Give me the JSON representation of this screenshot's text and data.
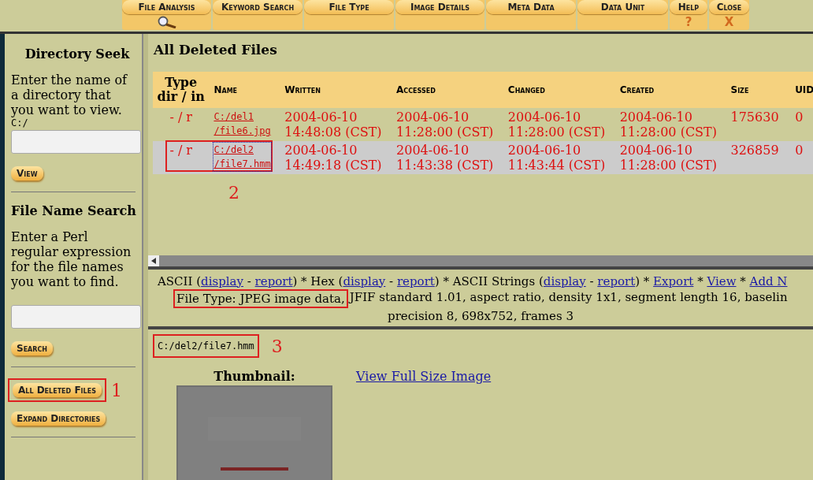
{
  "toolbar": {
    "tabs": [
      {
        "label": "File Analysis",
        "selected": true
      },
      {
        "label": "Keyword Search",
        "selected": false
      },
      {
        "label": "File Type",
        "selected": false
      },
      {
        "label": "Image Details",
        "selected": false
      },
      {
        "label": "Meta Data",
        "selected": false
      },
      {
        "label": "Data Unit",
        "selected": false
      },
      {
        "label": "Help",
        "selected": false,
        "glyph": "?"
      },
      {
        "label": "Close",
        "selected": false,
        "glyph": "X"
      }
    ]
  },
  "sidebar": {
    "sections": [
      {
        "title": "Directory Seek",
        "text": "Enter the name of a directory that you want to view.",
        "prefix": "C:/",
        "button": "View"
      },
      {
        "title": "File Name Search",
        "text": "Enter a Perl regular expression for the file names you want to find.",
        "button": "Search"
      }
    ],
    "actions": [
      {
        "label": "All Deleted Files",
        "highlighted": true,
        "marker": "1"
      },
      {
        "label": "Expand Directories",
        "highlighted": false
      }
    ]
  },
  "list": {
    "title": "All Deleted Files",
    "columns": [
      "Type dir / in",
      "Name",
      "Written",
      "Accessed",
      "Changed",
      "Created",
      "Size",
      "UID"
    ],
    "rows": [
      {
        "type": "- / r",
        "name": [
          "C:/del1",
          "/file6.jpg"
        ],
        "written": [
          "2004-06-10",
          "14:48:08 (CST)"
        ],
        "accessed": [
          "2004-06-10",
          "11:28:00 (CST)"
        ],
        "changed": [
          "2004-06-10",
          "11:28:00 (CST)"
        ],
        "created": [
          "2004-06-10",
          "11:28:00 (CST)"
        ],
        "size": "175630",
        "uid": "0",
        "selected": false,
        "highlighted": false
      },
      {
        "type": "- / r",
        "name": [
          "C:/del2",
          "/file7.hmm"
        ],
        "written": [
          "2004-06-10",
          "14:49:18 (CST)"
        ],
        "accessed": [
          "2004-06-10",
          "11:43:38 (CST)"
        ],
        "changed": [
          "2004-06-10",
          "11:43:44 (CST)"
        ],
        "created": [
          "2004-06-10",
          "11:28:00 (CST)"
        ],
        "size": "326859",
        "uid": "0",
        "selected": true,
        "highlighted": true,
        "marker": "2"
      }
    ]
  },
  "content_menu": [
    {
      "kind": "text",
      "text": "ASCII ("
    },
    {
      "kind": "link",
      "text": "display"
    },
    {
      "kind": "text",
      "text": " - "
    },
    {
      "kind": "link",
      "text": "report"
    },
    {
      "kind": "text",
      "text": ") * Hex ("
    },
    {
      "kind": "link",
      "text": "display"
    },
    {
      "kind": "text",
      "text": " - "
    },
    {
      "kind": "link",
      "text": "report"
    },
    {
      "kind": "text",
      "text": ") * ASCII Strings ("
    },
    {
      "kind": "link",
      "text": "display"
    },
    {
      "kind": "text",
      "text": " - "
    },
    {
      "kind": "link",
      "text": "report"
    },
    {
      "kind": "text",
      "text": ") * "
    },
    {
      "kind": "link",
      "text": "Export"
    },
    {
      "kind": "text",
      "text": " * "
    },
    {
      "kind": "link",
      "text": "View"
    },
    {
      "kind": "text",
      "text": " * "
    },
    {
      "kind": "link",
      "text": "Add N"
    }
  ],
  "file_type": {
    "lead": "File Type: JPEG image data,",
    "lead_highlighted": true,
    "rest": "JFIF standard 1.01, aspect ratio, density 1x1, segment length 16, baselin",
    "line2": "precision 8, 698x752, frames 3"
  },
  "viewer": {
    "path": "C:/del2/file7.hmm",
    "path_highlighted": true,
    "marker": "3",
    "thumbnail_label": "Thumbnail:",
    "full_size_link": "View Full Size Image"
  }
}
